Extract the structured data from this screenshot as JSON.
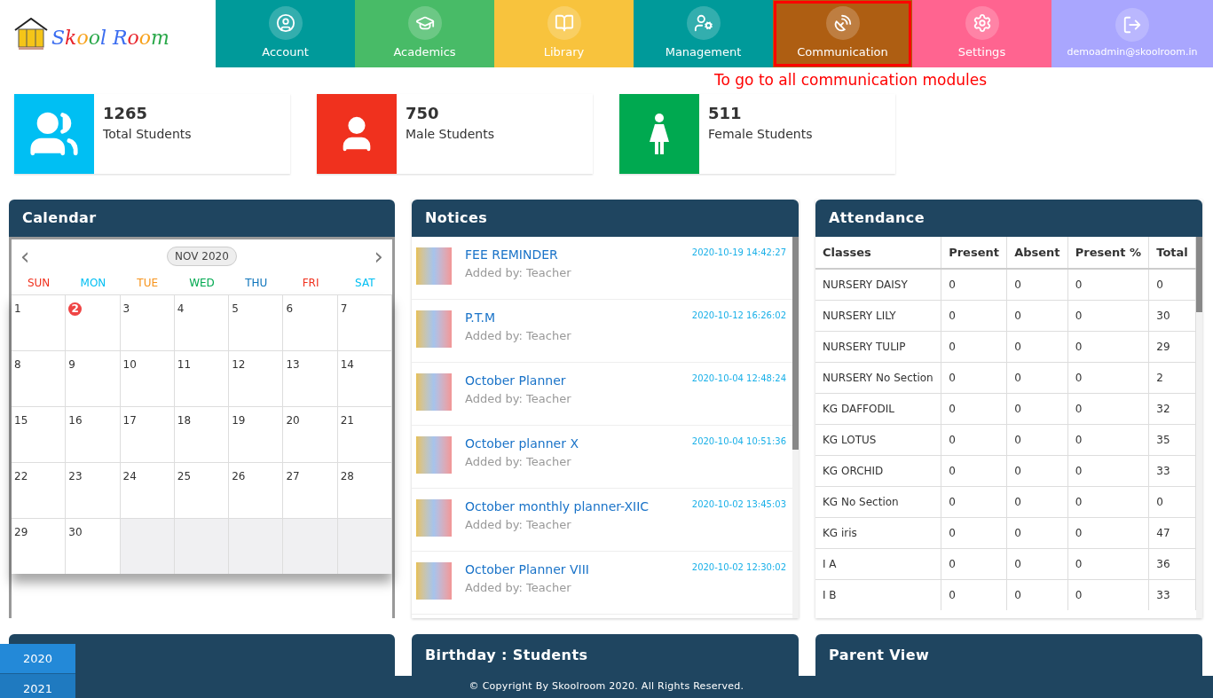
{
  "logo": {
    "text": "Skool Room"
  },
  "nav": [
    {
      "label": "Account",
      "color": "#009a9a",
      "selected": false
    },
    {
      "label": "Academics",
      "color": "#48bb67",
      "selected": false
    },
    {
      "label": "Library",
      "color": "#f8c33d",
      "selected": false
    },
    {
      "label": "Management",
      "color": "#009a9a",
      "selected": false
    },
    {
      "label": "Communication",
      "color": "#ae5e12",
      "selected": true
    },
    {
      "label": "Settings",
      "color": "#ff6490",
      "selected": false
    },
    {
      "label": "demoadmin@skoolroom.in",
      "color": "#a9a6fe",
      "selected": false
    }
  ],
  "annotation": "To go to all communication modules",
  "stats": [
    {
      "value": "1265",
      "label": "Total Students",
      "color": "#00bff3"
    },
    {
      "value": "750",
      "label": "Male Students",
      "color": "#f0311e"
    },
    {
      "value": "511",
      "label": "Female Students",
      "color": "#00a950"
    }
  ],
  "calendar": {
    "title": "Calendar",
    "prev": "‹",
    "next": "›",
    "month": "NOV 2020",
    "weekdays": [
      {
        "label": "SUN",
        "color": "#f0311e"
      },
      {
        "label": "MON",
        "color": "#00bff3"
      },
      {
        "label": "TUE",
        "color": "#f7941d"
      },
      {
        "label": "WED",
        "color": "#00a950"
      },
      {
        "label": "THU",
        "color": "#0f75bc"
      },
      {
        "label": "FRI",
        "color": "#f0311e"
      },
      {
        "label": "SAT",
        "color": "#00bff3"
      }
    ],
    "days": [
      {
        "label": "1",
        "today": false
      },
      {
        "label": "2",
        "today": true
      },
      {
        "label": "3",
        "today": false
      },
      {
        "label": "4",
        "today": false
      },
      {
        "label": "5",
        "today": false
      },
      {
        "label": "6",
        "today": false
      },
      {
        "label": "7",
        "today": false
      },
      {
        "label": "8",
        "today": false
      },
      {
        "label": "9",
        "today": false
      },
      {
        "label": "10",
        "today": false
      },
      {
        "label": "11",
        "today": false
      },
      {
        "label": "12",
        "today": false
      },
      {
        "label": "13",
        "today": false
      },
      {
        "label": "14",
        "today": false
      },
      {
        "label": "15",
        "today": false
      },
      {
        "label": "16",
        "today": false
      },
      {
        "label": "17",
        "today": false
      },
      {
        "label": "18",
        "today": false
      },
      {
        "label": "19",
        "today": false
      },
      {
        "label": "20",
        "today": false
      },
      {
        "label": "21",
        "today": false
      },
      {
        "label": "22",
        "today": false
      },
      {
        "label": "23",
        "today": false
      },
      {
        "label": "24",
        "today": false
      },
      {
        "label": "25",
        "today": false
      },
      {
        "label": "26",
        "today": false
      },
      {
        "label": "27",
        "today": false
      },
      {
        "label": "28",
        "today": false
      },
      {
        "label": "29",
        "today": false
      },
      {
        "label": "30",
        "today": false
      }
    ]
  },
  "notices": {
    "title": "Notices",
    "items": [
      {
        "title": "FEE REMINDER",
        "by": "Added by: Teacher",
        "time": "2020-10-19 14:42:27"
      },
      {
        "title": "P.T.M",
        "by": "Added by: Teacher",
        "time": "2020-10-12 16:26:02"
      },
      {
        "title": "October Planner",
        "by": "Added by: Teacher",
        "time": "2020-10-04 12:48:24"
      },
      {
        "title": "October planner X",
        "by": "Added by: Teacher",
        "time": "2020-10-04 10:51:36"
      },
      {
        "title": "October monthly planner-XIIC",
        "by": "Added by: Teacher",
        "time": "2020-10-02 13:45:03"
      },
      {
        "title": "October Planner VIII",
        "by": "Added by: Teacher",
        "time": "2020-10-02 12:30:02"
      }
    ]
  },
  "attendance": {
    "title": "Attendance",
    "columns": [
      "Classes",
      "Present",
      "Absent",
      "Present %",
      "Total"
    ],
    "rows": [
      [
        "NURSERY DAISY",
        "0",
        "0",
        "0",
        "0"
      ],
      [
        "NURSERY LILY",
        "0",
        "0",
        "0",
        "30"
      ],
      [
        "NURSERY TULIP",
        "0",
        "0",
        "0",
        "29"
      ],
      [
        "NURSERY No Section",
        "0",
        "0",
        "0",
        "2"
      ],
      [
        "KG DAFFODIL",
        "0",
        "0",
        "0",
        "32"
      ],
      [
        "KG LOTUS",
        "0",
        "0",
        "0",
        "35"
      ],
      [
        "KG ORCHID",
        "0",
        "0",
        "0",
        "33"
      ],
      [
        "KG No Section",
        "0",
        "0",
        "0",
        "0"
      ],
      [
        "KG iris",
        "0",
        "0",
        "0",
        "47"
      ],
      [
        "I A",
        "0",
        "0",
        "0",
        "36"
      ],
      [
        "I B",
        "0",
        "0",
        "0",
        "33"
      ]
    ]
  },
  "bottom_panels": [
    {
      "title": "Birthday : Students"
    },
    {
      "title": "Parent View"
    }
  ],
  "years": [
    {
      "label": "2020",
      "selected": true
    },
    {
      "label": "2021",
      "selected": false
    }
  ],
  "footer": "© Copyright By Skoolroom 2020. All Rights Reserved."
}
